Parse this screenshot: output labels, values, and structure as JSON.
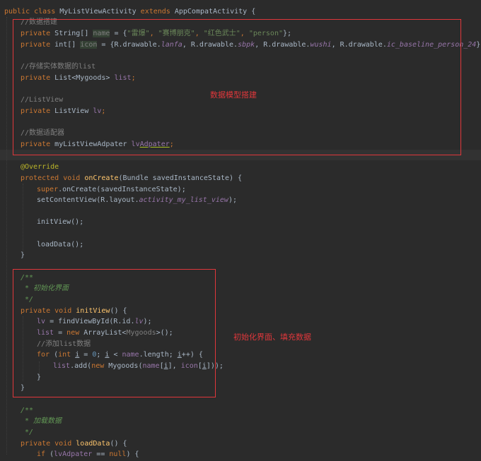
{
  "code": {
    "line_01": {
      "kw1": "public class ",
      "cls": "MyListViewActivity ",
      "kw2": "extends ",
      "base": "AppCompatActivity {"
    },
    "line_02": {
      "cmt": "//数据搭建"
    },
    "line_03": {
      "kw": "private ",
      "type": "String[] ",
      "fld": "name",
      "eq": " = {",
      "s1": "\"雷爆\"",
      "c1": ", ",
      "s2": "\"赛博朋克\"",
      "c2": ", ",
      "s3": "\"红色武士\"",
      "c3": ", ",
      "s4": "\"person\"",
      "end": "};"
    },
    "line_04": {
      "kw": "private ",
      "type": "int[] ",
      "fld": "icon",
      "eq": " = {R.drawable.",
      "f1": "lanfa",
      "c1": ", R.drawable.",
      "f2": "sbpk",
      "c2": ", R.drawable.",
      "f3": "wushi",
      "c3": ", R.drawable.",
      "f4": "ic_baseline_person_24",
      "end": "};"
    },
    "line_05": {
      "cmt": "//存储实体数据的list"
    },
    "line_06": {
      "kw": "private ",
      "type": "List<Mygoods> ",
      "fld": "list",
      "end": ";"
    },
    "line_07": {
      "cmt": "//ListView"
    },
    "line_08": {
      "kw": "private ",
      "type": "ListView ",
      "fld": "lv",
      "end": ";"
    },
    "line_09": {
      "cmt": "//数据适配器"
    },
    "line_10": {
      "kw": "private ",
      "type": "myListViewAdpater ",
      "fld_a": "lv",
      "fld_b": "Adpater",
      "end": ";"
    },
    "line_11": {
      "ann": "@Override"
    },
    "line_12": {
      "kw": "protected void ",
      "fn": "onCreate",
      "rest": "(Bundle savedInstanceState) {"
    },
    "line_13": {
      "kw": "super",
      "rest": ".onCreate(savedInstanceState);"
    },
    "line_14": {
      "a": "setContentView(R.layout.",
      "f": "activity_my_list_view",
      "b": ");"
    },
    "line_15": {
      "text": "initView();"
    },
    "line_16": {
      "text": "loadData();"
    },
    "line_17": {
      "text": "}"
    },
    "line_18": {
      "doc": "/**"
    },
    "line_19": {
      "doc": " * 初始化界面"
    },
    "line_20": {
      "doc": " */"
    },
    "line_21": {
      "kw": "private void ",
      "fn": "initView",
      "rest": "() {"
    },
    "line_22": {
      "fld": "lv",
      "a": " = findViewById(R.id.",
      "f": "lv",
      "b": ");"
    },
    "line_23": {
      "fld": "list",
      "a": " = ",
      "kw": "new ",
      "b": "ArrayList<",
      "gen": "Mygoods",
      "c": ">();"
    },
    "line_24": {
      "cmt": "//添加list数据"
    },
    "line_25": {
      "kw": "for ",
      "a": "(",
      "kw2": "int ",
      "v": "i",
      "b": " = ",
      "num": "0",
      "c": "; ",
      "v2": "i",
      "d": " < ",
      "fld": "name",
      "e": ".length; ",
      "v3": "i",
      "f": "++) {"
    },
    "line_26": {
      "fld": "list",
      "a": ".add(",
      "kw": "new ",
      "b": "Mygoods(",
      "fld2": "name",
      "c": "[",
      "v": "i",
      "d": "], ",
      "fld3": "icon",
      "e": "[",
      "v2": "i",
      "f": "]));"
    },
    "line_27": {
      "text": "}"
    },
    "line_28": {
      "text": "}"
    },
    "line_29": {
      "doc": "/**"
    },
    "line_30": {
      "doc": " * 加载数据"
    },
    "line_31": {
      "doc": " */"
    },
    "line_32": {
      "kw": "private void ",
      "fn": "loadData",
      "rest": "() {"
    },
    "line_33": {
      "kw": "if ",
      "a": "(",
      "fld": "lvAdpater",
      "b": " == ",
      "kw2": "null",
      "c": ") {"
    }
  },
  "annotations": {
    "box1_label": "数据模型搭建",
    "box2_label": "初始化界面、填充数据",
    "color": "#e0373b"
  },
  "theme": {
    "background": "#2b2b2b",
    "keyword": "#cc7832",
    "string": "#6a8759",
    "field": "#9876aa",
    "comment": "#808080",
    "javadoc": "#629755",
    "method": "#ffc66d",
    "annotation": "#bbb529"
  }
}
